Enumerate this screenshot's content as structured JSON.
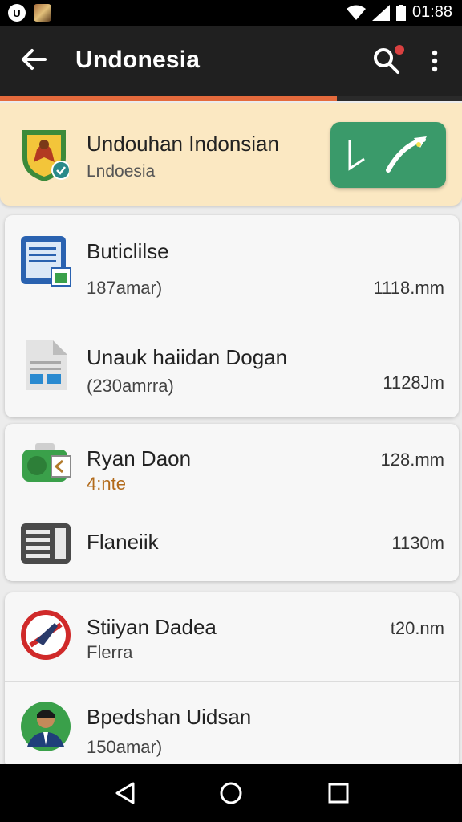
{
  "status_bar": {
    "time": "01:88",
    "app_icon_letter": "U"
  },
  "app_bar": {
    "title": "Undonesia"
  },
  "page_progress": {
    "fraction": 0.73,
    "color": "#e46a3c"
  },
  "hero": {
    "title": "Undouhan Indonsian",
    "subtitle": "Lndoesia",
    "action_icon": "trend-arrow-icon",
    "accent": "#3a9a6a"
  },
  "groups": [
    {
      "items": [
        {
          "name": "Buticlilse",
          "sub": "187amar)",
          "meta": "1118.mm",
          "icon": "tablet-document-icon"
        },
        {
          "name": "Unauk haiidan Dogan",
          "sub": "(230amrra)",
          "meta": "1128Jm",
          "icon": "document-file-icon"
        }
      ]
    },
    {
      "items": [
        {
          "name": "Ryan Daon",
          "sub": "4:nte",
          "meta": "128.mm",
          "icon": "green-device-icon"
        },
        {
          "name": "Flaneiik",
          "sub": "",
          "meta": "1130m",
          "icon": "film-strip-icon"
        }
      ]
    },
    {
      "items": [
        {
          "name": "Stiiyan Dadea",
          "sub": "Flerra",
          "meta": "t20.nm",
          "icon": "no-flight-icon"
        },
        {
          "name": "Bpedshan Uidsan",
          "sub": "150amar)",
          "meta": "",
          "icon": "user-avatar-icon"
        }
      ]
    }
  ]
}
